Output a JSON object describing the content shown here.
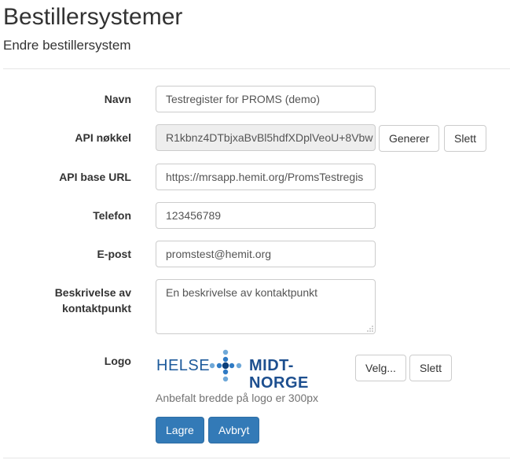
{
  "page": {
    "title": "Bestillersystemer",
    "subtitle": "Endre bestillersystem"
  },
  "form": {
    "navn": {
      "label": "Navn",
      "value": "Testregister for PROMS (demo)"
    },
    "api_key": {
      "label": "API nøkkel",
      "value": "R1kbnz4DTbjxaBvBl5hdfXDplVeoU+8Vbw",
      "generate_label": "Generer",
      "delete_label": "Slett"
    },
    "api_base_url": {
      "label": "API base URL",
      "value": "https://mrsapp.hemit.org/PromsTestregis"
    },
    "telefon": {
      "label": "Telefon",
      "value": "123456789"
    },
    "epost": {
      "label": "E-post",
      "value": "promstest@hemit.org"
    },
    "beskrivelse": {
      "label_line1": "Beskrivelse av",
      "label_line2": "kontaktpunkt",
      "value": "En beskrivelse av kontaktpunkt"
    },
    "logo": {
      "label": "Logo",
      "logo_text_left": "HELSE",
      "logo_text_right": "MIDT-NORGE",
      "logo_color": "#1d5a9b",
      "choose_label": "Velg...",
      "delete_label": "Slett",
      "help_text": "Anbefalt bredde på logo er 300px"
    },
    "actions": {
      "save_label": "Lagre",
      "cancel_label": "Avbryt",
      "primary_color": "#337ab7"
    }
  }
}
